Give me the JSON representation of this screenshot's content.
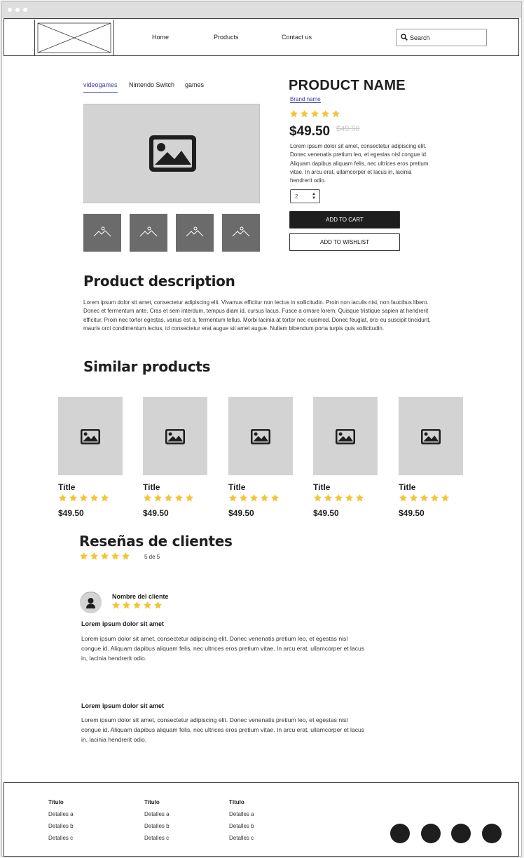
{
  "nav": {
    "links": [
      "Home",
      "Products",
      "Contact us"
    ],
    "search_placeholder": "Search"
  },
  "breadcrumb": [
    "videogames",
    "Nintendo Switch",
    "games"
  ],
  "product": {
    "name": "PRODUCT NAME",
    "brand": "Brand name",
    "rating": 5,
    "price": "$49.50",
    "old_price": "$49.50",
    "description": "Lorem ipsum dolor sit amet, consectetur adipiscing elit. Donec venenatis pretium leo, et egestas nisl congue id. Aliquam dapibus aliquam felis, nec ultrices eros pretium vitae. In arcu erat, ullamcorper et lacus in, lacinia hendrerit odio.",
    "quantity": "2",
    "add_to_cart": "ADD TO CART",
    "add_to_wishlist": "ADD TO WISHLIST"
  },
  "description_section": {
    "title": "Product description",
    "body": "Lorem ipsum dolor sit amet, consectetur adipiscing elit. Vivamus efficitur non lectus in sollicitudin. Proin non iaculis nisi, non faucibus libero. Donec et fermentum ante. Cras et sem interdum, tempus diam id, cursus lacus. Fusce a ornare lorem. Quisque tristique sapien at hendrerit efficitur. Proin nec tortor egestas, varius est a, fermentum tellus. Morbi lacinia at tortor nec euismod. Donec feugiat, orci eu suscipit tincidunt, mauris orci condimentum lectus, id consectetur erat augue sit amet augue. Nullam bibendum porta turpis quis sollicitudin."
  },
  "similar": {
    "title": "Similar products",
    "items": [
      {
        "title": "Title",
        "price": "$49.50",
        "rating": 5
      },
      {
        "title": "Title",
        "price": "$49.50",
        "rating": 5
      },
      {
        "title": "Title",
        "price": "$49.50",
        "rating": 5
      },
      {
        "title": "Title",
        "price": "$49.50",
        "rating": 5
      },
      {
        "title": "Title",
        "price": "$49.50",
        "rating": 5
      }
    ]
  },
  "reviews": {
    "title": "Reseñas de clientes",
    "rating": 5,
    "rating_text": "5 de 5",
    "items": [
      {
        "author": "Nombre del cliente",
        "rating": 5,
        "title": "Lorem ipsum dolor sit amet",
        "body": "Lorem ipsum dolor sit amet, consectetur adipiscing elit. Donec venenatis pretium leo, et egestas nisl congue id. Aliquam dapibus aliquam felis, nec ultrices eros pretium vitae. In arcu erat, ullamcorper et lacus in, lacinia hendrerit odio."
      },
      {
        "title": "Lorem ipsum dolor sit amet",
        "body": "Lorem ipsum dolor sit amet, consectetur adipiscing elit. Donec venenatis pretium leo, et egestas nisl congue id. Aliquam dapibus aliquam felis, nec ultrices eros pretium vitae. In arcu erat, ullamcorper et lacus in, lacinia hendrerit odio."
      }
    ]
  },
  "footer": {
    "columns": [
      {
        "title": "Título",
        "items": [
          "Detalles a",
          "Detalles b",
          "Detalles c"
        ]
      },
      {
        "title": "Título",
        "items": [
          "Detalles a",
          "Detalles b",
          "Detalles c"
        ]
      },
      {
        "title": "Título",
        "items": [
          "Detalles a",
          "Detalles b",
          "Detalles c"
        ]
      }
    ],
    "social_count": 4
  },
  "colors": {
    "star": "#f2c438",
    "link": "#3a3ab8",
    "placeholder": "#d3d3d3",
    "dark": "#1e1e1e"
  }
}
